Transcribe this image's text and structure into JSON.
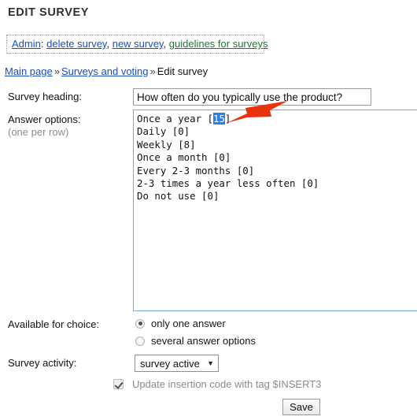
{
  "page": {
    "title": "EDIT SURVEY"
  },
  "admin_bar": {
    "prefix": "Admin",
    "colon": ":",
    "links": [
      {
        "label": "delete survey",
        "color": "#1a4fb4"
      },
      {
        "label": "new survey",
        "color": "#1a4fb4"
      },
      {
        "label": "guidelines for surveys",
        "color": "#1b7a2e"
      }
    ],
    "separator": ", "
  },
  "breadcrumb": {
    "items": [
      {
        "label": "Main page",
        "link": true
      },
      {
        "label": "Surveys and voting",
        "link": true
      },
      {
        "label": "Edit survey",
        "link": false
      }
    ],
    "separator": "»"
  },
  "form": {
    "heading_field": {
      "label": "Survey heading:",
      "value": "How often do you typically use the product?",
      "placeholder": ""
    },
    "options_field": {
      "label": "Answer options:",
      "sublabel": "(one per row)",
      "lines": [
        {
          "text_before": "Once a year [",
          "selected": "15",
          "text_after": "]"
        },
        {
          "text_before": "Daily [0]",
          "selected": "",
          "text_after": ""
        },
        {
          "text_before": "Weekly [8]",
          "selected": "",
          "text_after": ""
        },
        {
          "text_before": "Once a month [0]",
          "selected": "",
          "text_after": ""
        },
        {
          "text_before": "Every 2-3 months [0]",
          "selected": "",
          "text_after": ""
        },
        {
          "text_before": "2-3 times a year less often [0]",
          "selected": "",
          "text_after": ""
        },
        {
          "text_before": "Do not use [0]",
          "selected": "",
          "text_after": ""
        }
      ]
    },
    "choice_field": {
      "label": "Available for choice:",
      "options": [
        {
          "label": "only one answer",
          "checked": true
        },
        {
          "label": "several answer options",
          "checked": false
        }
      ]
    },
    "activity_field": {
      "label": "Survey activity:",
      "value": "survey active",
      "caret": "▼",
      "options": [
        "survey active"
      ]
    },
    "insert_checkbox": {
      "label": "Update insertion code with tag $INSERT3",
      "checked": true,
      "disabled": true
    },
    "save_button": {
      "label": "Save"
    }
  },
  "annotation": {
    "arrow": {
      "name": "red-arrow-annotation",
      "color": "#e8320c",
      "points_to": "15"
    }
  },
  "colors": {
    "link_blue": "#1a4fb4",
    "link_green": "#1b7a2e",
    "selection_blue": "#2a7fe8",
    "textarea_border": "#7aa9e0",
    "muted_text": "#8a8a8a"
  }
}
